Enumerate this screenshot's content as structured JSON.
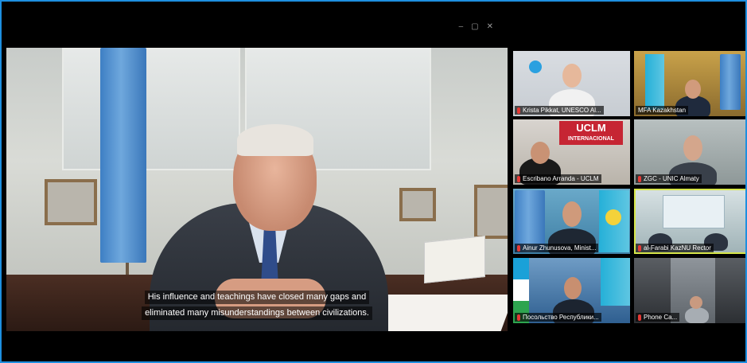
{
  "window": {
    "controls": [
      "–",
      "▢",
      "✕"
    ]
  },
  "main_video": {
    "subtitles": [
      "His influence and teachings have closed many gaps and",
      "eliminated many misunderstandings between civilizations."
    ]
  },
  "gallery": [
    {
      "name": "Krista Pikkat, UNESCO Al..."
    },
    {
      "name": "MFA Kazakhstan"
    },
    {
      "name": "Escribano Arranda - UCLM",
      "banner_title": "UCLM",
      "banner_subtitle": "INTERNACIONAL"
    },
    {
      "name": "ZGC - UNIC Almaty"
    },
    {
      "name": "Ainur Zhunusova, Minist..."
    },
    {
      "name": "al-Farabi KazNU Rector"
    },
    {
      "name": "Посольство Республики..."
    },
    {
      "name": "Phone Ca..."
    }
  ],
  "colors": {
    "accent_border": "#1d8fe0",
    "mic_muted": "#e53935",
    "active_speaker": "#d7e64a"
  }
}
